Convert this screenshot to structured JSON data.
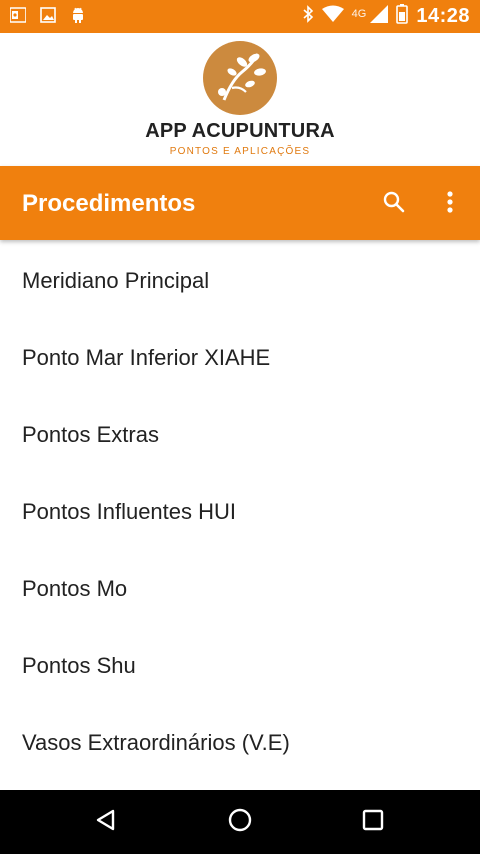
{
  "status_bar": {
    "network_label": "4G",
    "time": "14:28",
    "icons": [
      "outlook-icon",
      "image-icon",
      "android-icon",
      "bluetooth-icon",
      "wifi-icon",
      "signal-icon",
      "battery-icon"
    ]
  },
  "header": {
    "brand_name": "APP ACUPUNTURA",
    "tagline": "PONTOS E APLICAÇÕES"
  },
  "toolbar": {
    "title": "Procedimentos",
    "icons": [
      "search-icon",
      "more-vert-icon"
    ]
  },
  "list": {
    "items": [
      {
        "label": "Meridiano Principal"
      },
      {
        "label": "Ponto Mar Inferior XIAHE"
      },
      {
        "label": "Pontos Extras"
      },
      {
        "label": "Pontos Influentes HUI"
      },
      {
        "label": "Pontos Mo"
      },
      {
        "label": "Pontos Shu"
      },
      {
        "label": "Vasos Extraordinários (V.E)"
      }
    ]
  },
  "nav_bar": {
    "icons": [
      "back-icon",
      "home-icon",
      "recents-icon"
    ]
  },
  "colors": {
    "accent": "#f0800e",
    "logo": "#cc8a3e",
    "text": "#222222",
    "nav": "#000000"
  }
}
